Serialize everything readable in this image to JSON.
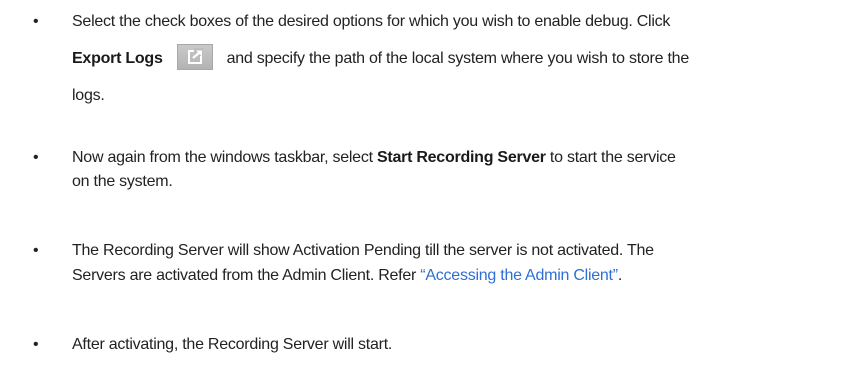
{
  "items": [
    {
      "bullet": "•",
      "line1": "Select the check boxes of the desired options for which you wish to enable debug. Click",
      "bold_label": "Export Logs",
      "icon": "export-icon",
      "line2_rest": "and specify the path of the local system where you wish to store the",
      "line3": "logs."
    },
    {
      "bullet": "•",
      "prefix": "Now again from the windows taskbar, select ",
      "bold": "Start Recording Server",
      "suffix": " to start the service",
      "line2": "on the system."
    },
    {
      "bullet": "•",
      "line1": "The Recording Server will show Activation Pending till the server is not activated. The",
      "line2_prefix": "Servers are activated from the Admin Client. Refer ",
      "link": "“Accessing the Admin Client”",
      "line2_suffix": "."
    },
    {
      "bullet": "•",
      "line1": "After activating, the Recording Server will start."
    }
  ],
  "colors": {
    "text": "#222222",
    "link": "#2f6fd6",
    "icon_bg": "#bdbdbd",
    "icon_fg": "#ffffff"
  }
}
